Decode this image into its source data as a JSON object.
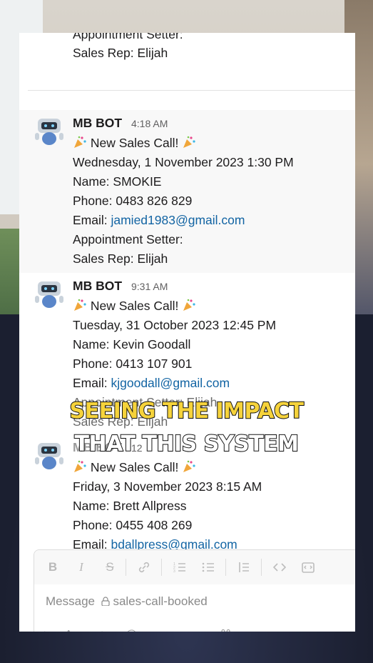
{
  "previous_message": {
    "clipped_line": "Appointment Setter:",
    "sales_rep": "Sales Rep: Elijah"
  },
  "messages": [
    {
      "sender": "MB BOT",
      "time": "4:18 AM",
      "headline": "New Sales Call!",
      "datetime": "Wednesday, 1 November 2023 1:30 PM",
      "name": "Name: SMOKIE",
      "phone": "Phone: 0483 826 829",
      "email_label": "Email: ",
      "email": "jamied1983@gmail.com",
      "setter": "Appointment Setter:",
      "sales_rep": "Sales Rep: Elijah"
    },
    {
      "sender": "MB BOT",
      "time": "9:31 AM",
      "headline": "New Sales Call!",
      "datetime": "Tuesday, 31 October 2023 12:45 PM",
      "name": "Name: Kevin Goodall",
      "phone": "Phone: 0413 107 901",
      "email_label": "Email: ",
      "email": "kjgoodall@gmail.com",
      "setter": "Appointment Setter: Elijah",
      "sales_rep": "Sales Rep: Elijah"
    },
    {
      "sender": "MB BOT",
      "time": "12",
      "headline": "New Sales Call!",
      "datetime": "Friday, 3 November 2023 8:15 AM",
      "name": "Name: Brett Allpress",
      "phone": "Phone: 0455 408 269",
      "email_label": "Email: ",
      "email": "bdallpress@gmail.com"
    }
  ],
  "composer": {
    "placeholder": "Message",
    "channel": "sales-call-booked",
    "toolbar": [
      "B",
      "I",
      "S",
      "link",
      "ordered-list",
      "bulleted-list",
      "quote",
      "code",
      "code-block"
    ]
  },
  "captions": {
    "line1": "SEEING THE IMPACT",
    "line2": "THAT THIS SYSTEM"
  },
  "colors": {
    "link": "#1264a3",
    "caption_yellow": "#f6d33b",
    "caption_white": "#ffffff"
  }
}
